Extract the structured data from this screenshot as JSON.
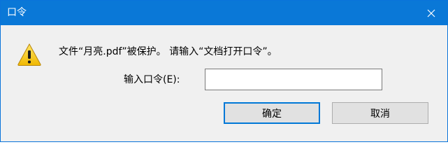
{
  "window": {
    "title": "口令"
  },
  "icons": {
    "close": "close-icon",
    "warning": "warning-icon"
  },
  "colors": {
    "titlebar": "#0a78d7",
    "accent": "#0078d7",
    "warning_yellow": "#f5c400"
  },
  "dialog": {
    "message": "文件“月亮.pdf”被保护。 请输入“文档打开口令”。",
    "password_label": "输入口令(E):",
    "password_value": "",
    "ok_label": "确定",
    "cancel_label": "取消"
  }
}
